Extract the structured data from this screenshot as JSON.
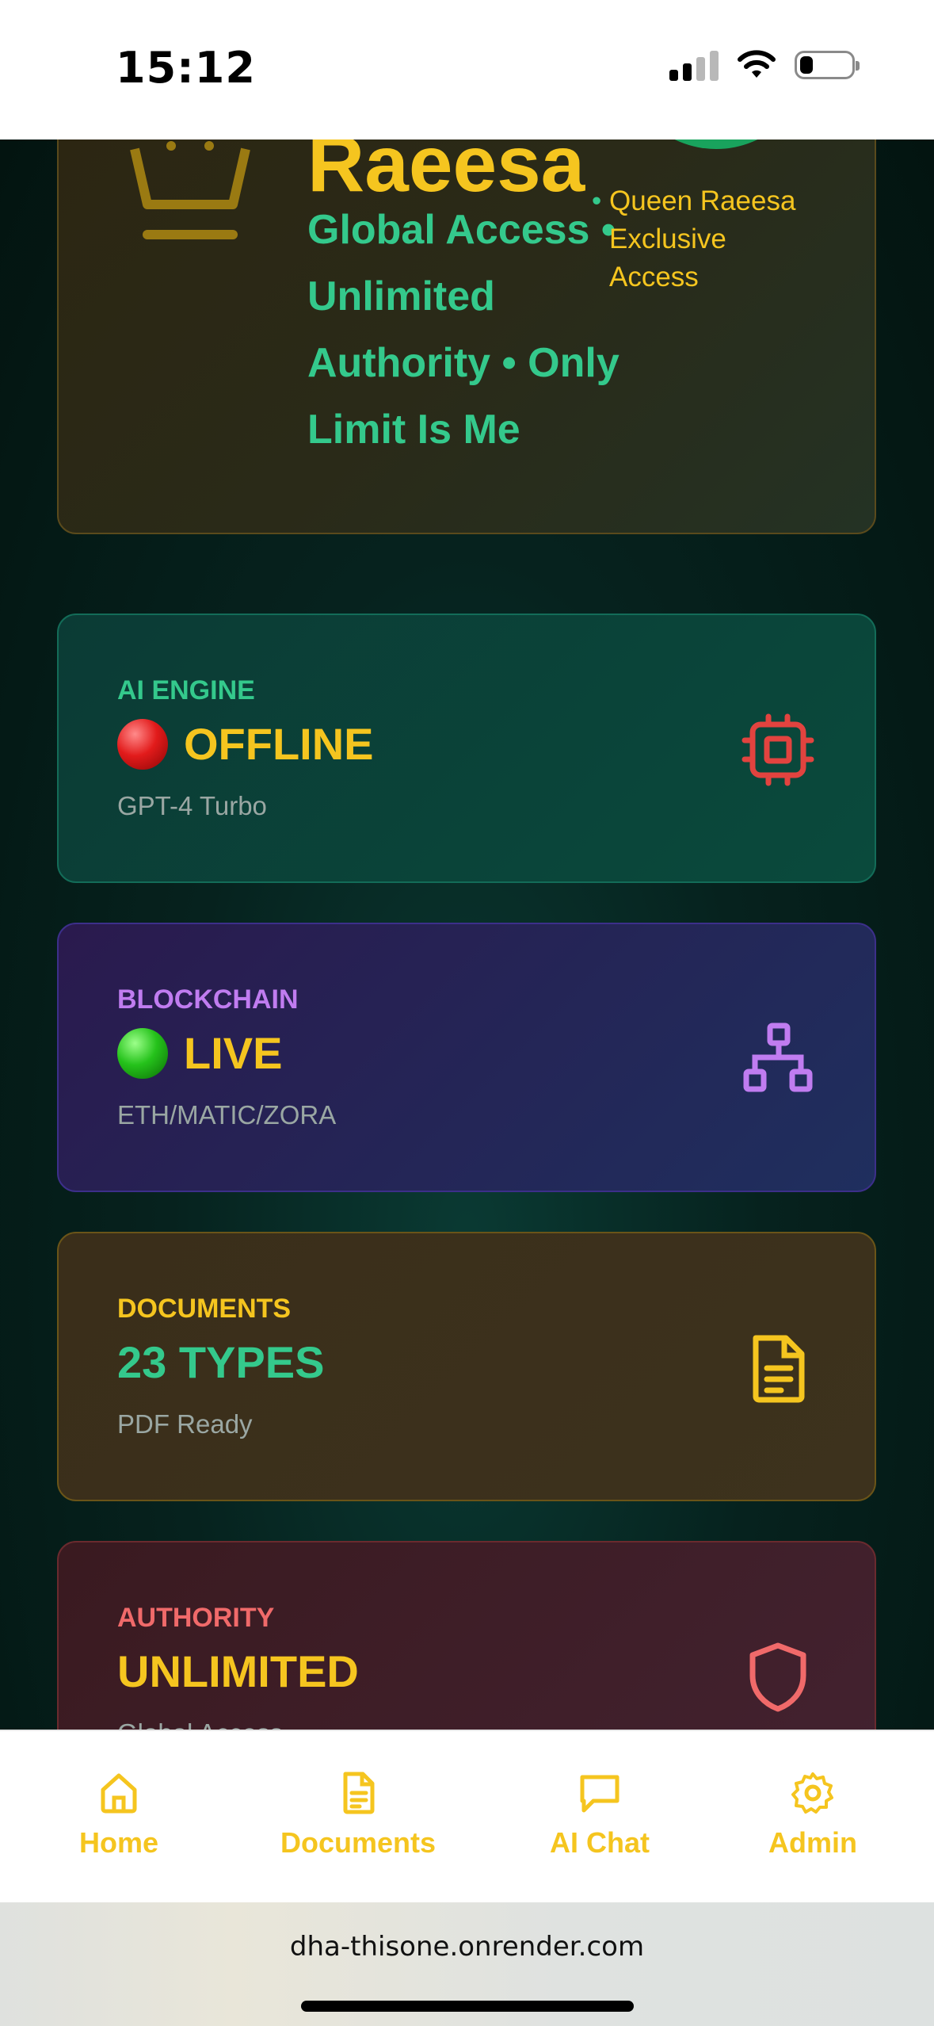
{
  "status_bar": {
    "time": "15:12"
  },
  "hero": {
    "name": "Raeesa",
    "subtitle": "Global Access • Unlimited Authority • Only Limit Is Me",
    "badge_text": "Queen Raeesa Exclusive Access"
  },
  "stats": [
    {
      "label": "AI ENGINE",
      "value": "OFFLINE",
      "indicator": "red-circle",
      "sub": "GPT-4 Turbo",
      "icon": "cpu-icon"
    },
    {
      "label": "BLOCKCHAIN",
      "value": "LIVE",
      "indicator": "green-circle",
      "sub": "ETH/MATIC/ZORA",
      "icon": "network-icon"
    },
    {
      "label": "DOCUMENTS",
      "value": "23 TYPES",
      "sub": "PDF Ready",
      "icon": "document-icon"
    },
    {
      "label": "AUTHORITY",
      "value": "UNLIMITED",
      "sub": "Global Access",
      "icon": "shield-icon"
    }
  ],
  "nav": [
    {
      "label": "Home",
      "icon": "home-icon"
    },
    {
      "label": "Documents",
      "icon": "document-icon"
    },
    {
      "label": "AI Chat",
      "icon": "chat-icon"
    },
    {
      "label": "Admin",
      "icon": "gear-icon"
    }
  ],
  "browser": {
    "url": "dha-thisone.onrender.com"
  },
  "colors": {
    "gold": "#f5c51f",
    "green": "#34c98c",
    "purple": "#c07cf0",
    "red": "#f06a6a",
    "badge_green": "#19a35d"
  }
}
